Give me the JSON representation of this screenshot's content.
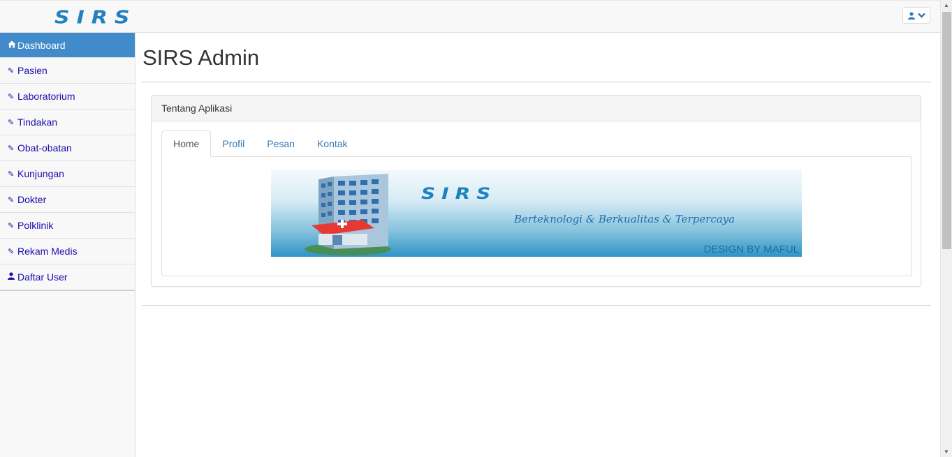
{
  "brand": "SIRS",
  "colors": {
    "accent": "#428bca",
    "link": "#1a0dab",
    "brand": "#1f82c0"
  },
  "sidebar": {
    "items": [
      {
        "label": "Dashboard",
        "icon": "home-icon",
        "active": true
      },
      {
        "label": "Pasien",
        "icon": "paperclip-icon"
      },
      {
        "label": "Laboratorium",
        "icon": "paperclip-icon"
      },
      {
        "label": "Tindakan",
        "icon": "paperclip-icon"
      },
      {
        "label": "Obat-obatan",
        "icon": "paperclip-icon"
      },
      {
        "label": "Kunjungan",
        "icon": "paperclip-icon"
      },
      {
        "label": "Dokter",
        "icon": "paperclip-icon"
      },
      {
        "label": "Polklinik",
        "icon": "paperclip-icon"
      },
      {
        "label": "Rekam Medis",
        "icon": "paperclip-icon"
      },
      {
        "label": "Daftar User",
        "icon": "user-icon"
      }
    ]
  },
  "main": {
    "title": "SIRS Admin",
    "panel": {
      "heading": "Tentang Aplikasi",
      "tabs": [
        {
          "label": "Home",
          "active": true
        },
        {
          "label": "Profil"
        },
        {
          "label": "Pesan"
        },
        {
          "label": "Kontak"
        }
      ],
      "banner": {
        "brand": "SIRS",
        "tagline": "Berteknologi & Berkualitas & Terpercaya",
        "credit": "DESIGN BY MAFUL"
      }
    }
  }
}
